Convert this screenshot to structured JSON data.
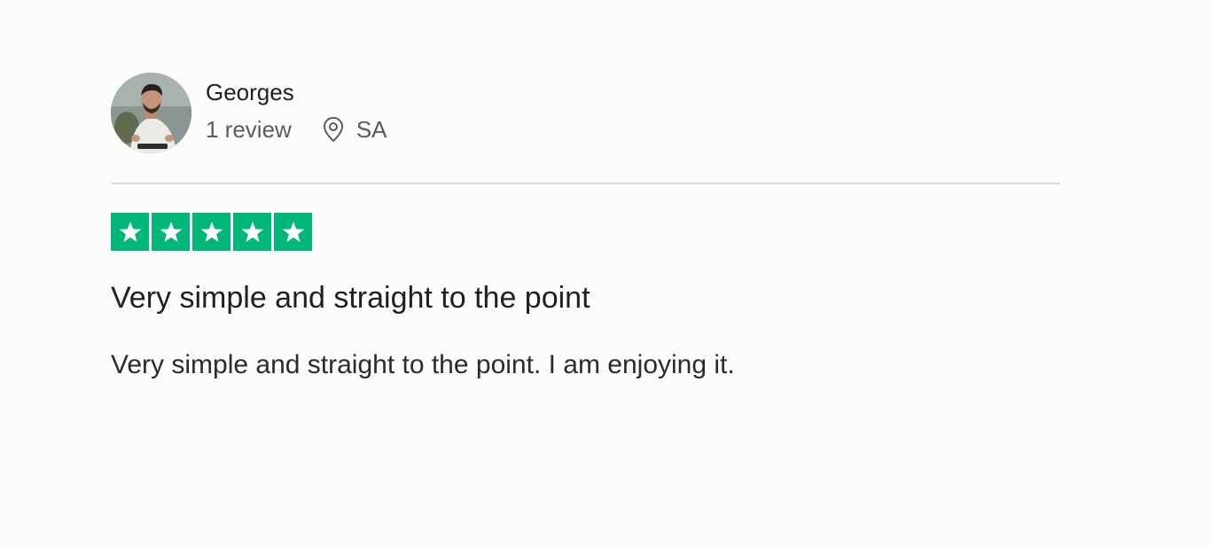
{
  "reviewer": {
    "name": "Georges",
    "review_count": "1 review",
    "country": "SA",
    "location_icon": "location-pin-icon",
    "avatar_icon": "avatar-photo"
  },
  "rating": {
    "stars": 5,
    "max_stars": 5,
    "star_color": "#00b67a",
    "star_icon": "star-icon"
  },
  "review": {
    "title": "Very simple and straight to the point",
    "text": "Very simple and straight to the point. I am enjoying it."
  },
  "colors": {
    "background": "#fcfcfb",
    "divider": "#dcdcdc",
    "text_primary": "#1f1f1f",
    "text_secondary": "#5b5b5b"
  }
}
